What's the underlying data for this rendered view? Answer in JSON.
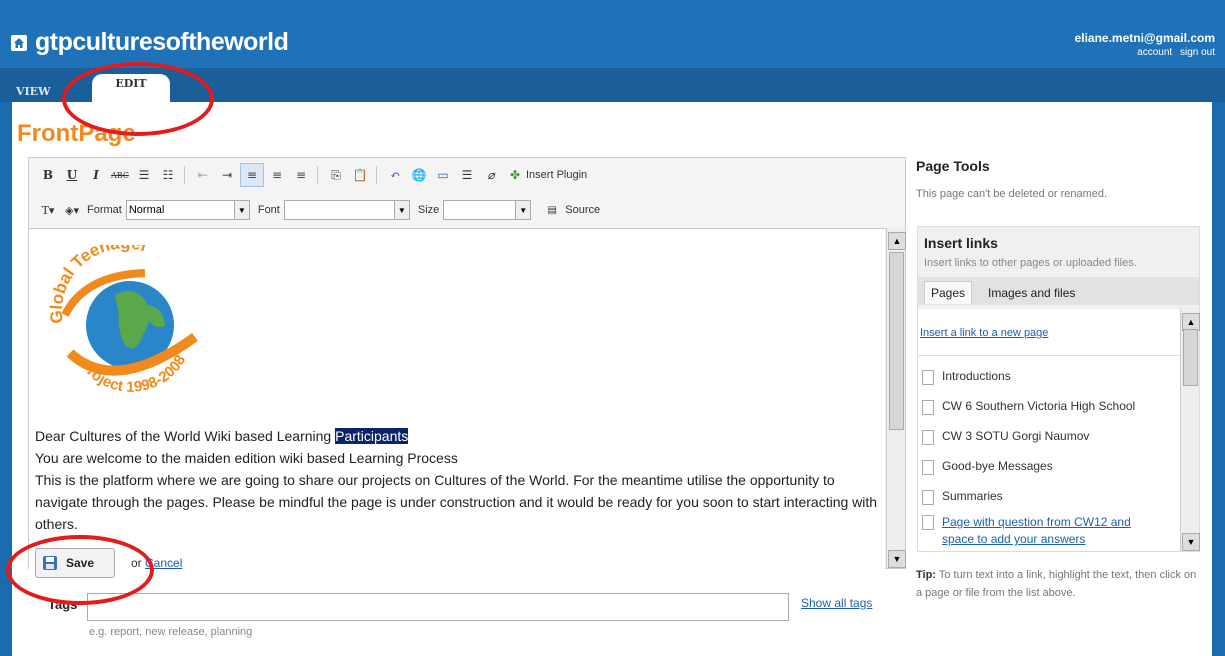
{
  "header": {
    "site_title": "gtpculturesoftheworld",
    "user_email": "eliane.metni@gmail.com",
    "account_label": "account",
    "signout_label": "sign out"
  },
  "tabs": [
    {
      "label": "VIEW"
    },
    {
      "label": "EDIT",
      "selected": true
    }
  ],
  "page": {
    "title": "FrontPage"
  },
  "toolbar": {
    "insert_plugin": "Insert Plugin",
    "format_label": "Format",
    "format_value": "Normal",
    "font_label": "Font",
    "font_value": "",
    "size_label": "Size",
    "size_value": "",
    "source_label": "Source"
  },
  "editor": {
    "logo_text_top": "Global Teenager",
    "logo_text_bottom": "Project 1998-2008",
    "line1_a": "Dear Cultures of the World Wiki based Learning ",
    "line1_b": "Participants",
    "line2": "You are welcome to the maiden edition wiki based  Learning Process",
    "line3": "This is the platform where we are going to share our projects on Cultures of the World. For the meantime utilise the opportunity to navigate through the pages. Please be mindful the page is under construction and it would be ready for you soon to start interacting with others."
  },
  "actions": {
    "save_label": "Save",
    "or_label": "or",
    "cancel_label": "Cancel"
  },
  "tags": {
    "label": "Tags",
    "value": "",
    "show_all": "Show all tags",
    "hint": "e.g. report, new release, planning"
  },
  "sidebar": {
    "title": "Page Tools",
    "note": "This page can't be deleted or renamed.",
    "insert_links": {
      "title": "Insert links",
      "desc": "Insert links to other pages or uploaded files.",
      "tabs": [
        "Pages",
        "Images and files"
      ],
      "new_page_link": "Insert a link to a new page",
      "items": [
        "Introductions",
        "CW 6 Southern Victoria High School",
        "CW 3 SOTU Gorgi Naumov",
        "Good-bye Messages",
        "Summaries",
        "Page with question from CW12 and space to add your answers"
      ]
    },
    "tip_label": "Tip:",
    "tip_text": " To turn text into a link, highlight the text, then click on a page or file from the list above."
  },
  "colors": {
    "header_blue": "#1f72b8",
    "title_orange": "#f08a1c",
    "annotation_red": "#e51b1b",
    "link_blue": "#1a5fb4"
  }
}
